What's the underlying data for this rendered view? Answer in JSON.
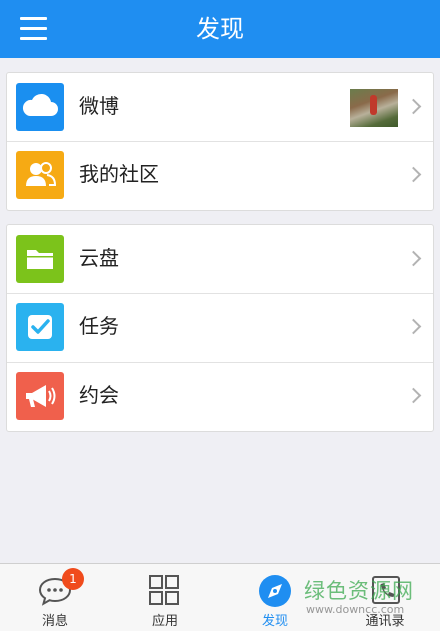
{
  "header": {
    "title": "发现",
    "menu_icon": "menu-icon"
  },
  "sections": [
    {
      "items": [
        {
          "label": "微博",
          "icon": "cloud-icon",
          "color": "#1a8ff0",
          "has_thumbnail": true
        },
        {
          "label": "我的社区",
          "icon": "users-icon",
          "color": "#f6aa14"
        }
      ]
    },
    {
      "items": [
        {
          "label": "云盘",
          "icon": "folder-icon",
          "color": "#7cc31b"
        },
        {
          "label": "任务",
          "icon": "checkbox-icon",
          "color": "#2ab2ef"
        },
        {
          "label": "约会",
          "icon": "megaphone-icon",
          "color": "#f0604c"
        }
      ]
    }
  ],
  "tabbar": {
    "tabs": [
      {
        "label": "消息",
        "icon": "chat-icon",
        "badge": "1"
      },
      {
        "label": "应用",
        "icon": "grid-icon"
      },
      {
        "label": "发现",
        "icon": "compass-icon",
        "active": true
      },
      {
        "label": "通讯录",
        "icon": "contacts-icon"
      }
    ]
  },
  "watermark": {
    "line1": "绿色资源网",
    "line2": "www.downcc.com"
  },
  "colors": {
    "accent": "#1f8ef1",
    "badge": "#f04b1c"
  }
}
